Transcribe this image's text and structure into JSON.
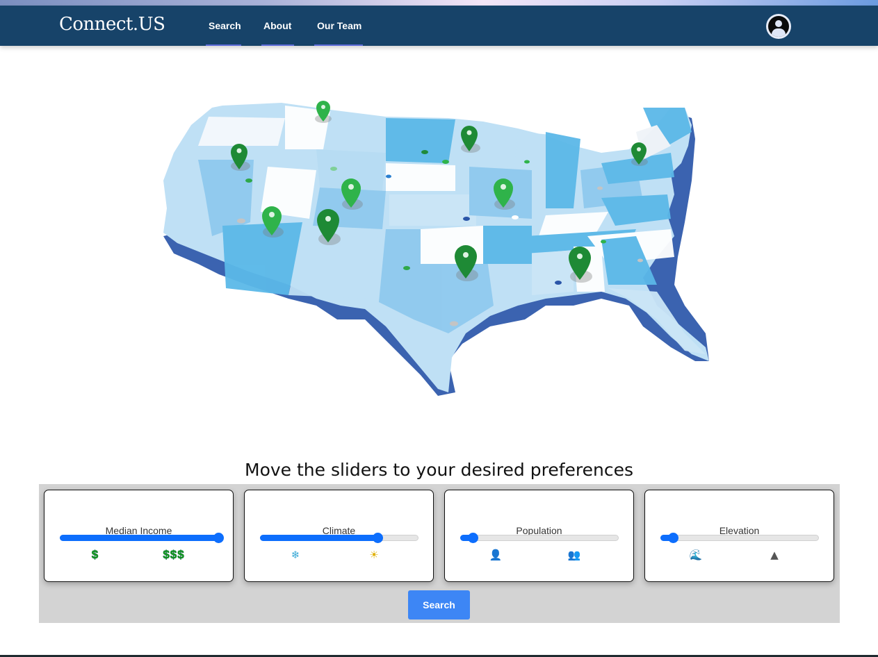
{
  "navbar": {
    "brand": "Connect.US",
    "links": [
      {
        "label": "Search"
      },
      {
        "label": "About"
      },
      {
        "label": "Our Team"
      }
    ],
    "account_icon": "user-circle-icon"
  },
  "hero": {
    "image_description": "3D map of the United States with green location pins",
    "pin_color_light": "#2fb34a",
    "pin_color_dark": "#1e8a35"
  },
  "preferences": {
    "prompt": "Move the sliders to your desired preferences",
    "sliders": [
      {
        "label": "Median Income",
        "value_percent": 100,
        "low_icon": "$",
        "high_icon": "$$$",
        "low_icon_name": "dollar-icon",
        "high_icon_name": "triple-dollar-icon"
      },
      {
        "label": "Climate",
        "value_percent": 74,
        "low_icon": "❄",
        "high_icon": "☀",
        "low_icon_name": "snowflake-icon",
        "high_icon_name": "sun-icon"
      },
      {
        "label": "Population",
        "value_percent": 8,
        "low_icon": "👤",
        "high_icon": "👥",
        "low_icon_name": "person-icon",
        "high_icon_name": "people-icon"
      },
      {
        "label": "Elevation",
        "value_percent": 8,
        "low_icon": "🌊",
        "high_icon": "▲",
        "low_icon_name": "wave-icon",
        "high_icon_name": "mountain-icon"
      }
    ],
    "search_button": "Search"
  },
  "colors": {
    "navbar": "#174369",
    "accent": "#0d6efd",
    "search_button": "#3d86f5",
    "panel": "#d3d3d3"
  }
}
